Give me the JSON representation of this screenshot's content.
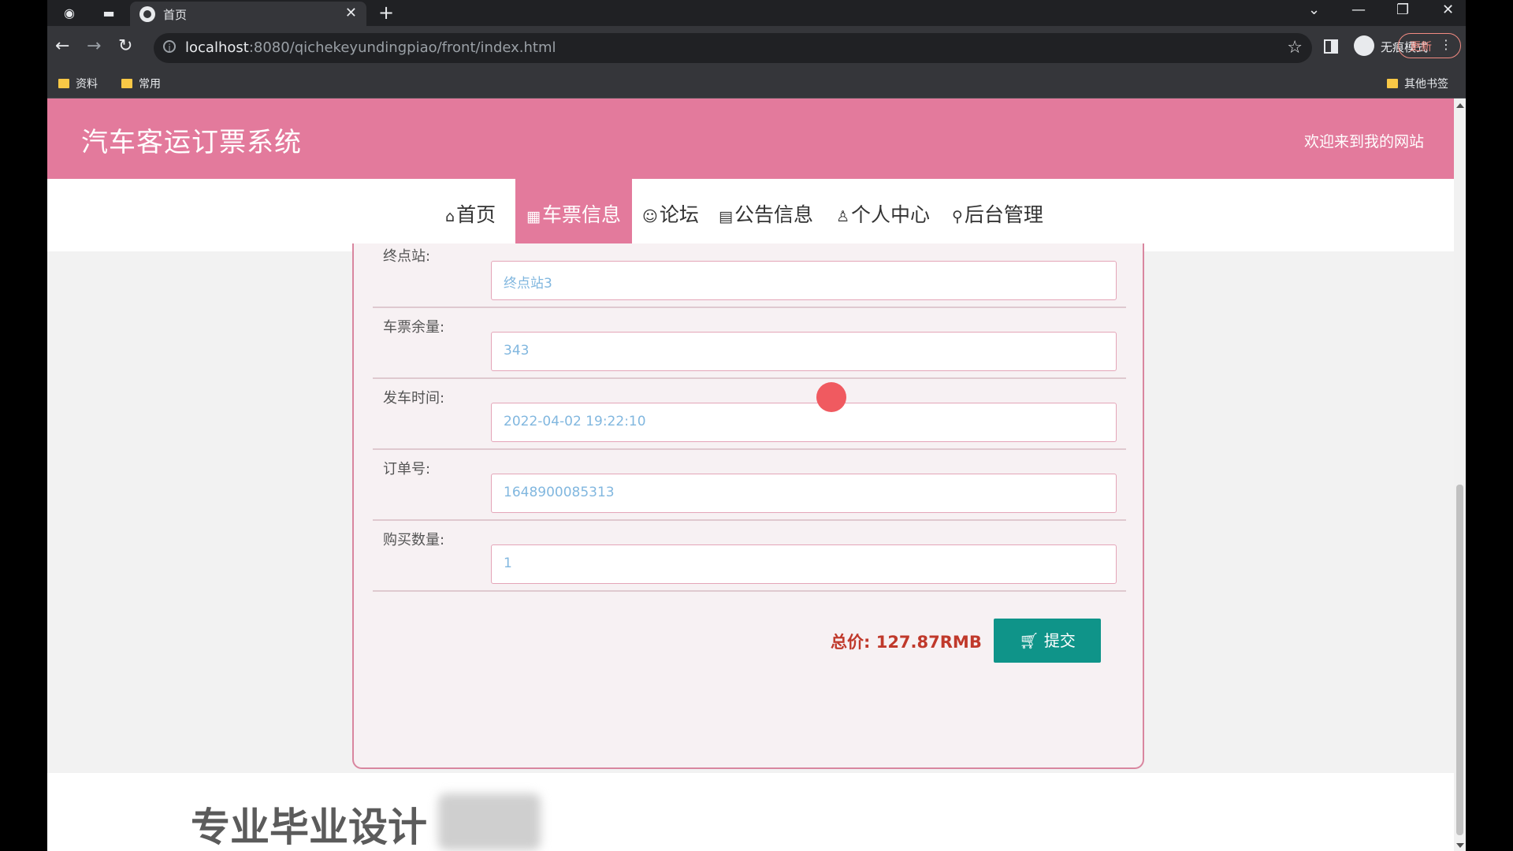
{
  "browser": {
    "tab_title": "首页",
    "url_host": "localhost",
    "url_rest": ":8080/qichekeyundingpiao/front/index.html",
    "incognito_label": "无痕模式",
    "update_label": "更新",
    "bookmarks": [
      "资料",
      "常用"
    ],
    "other_bookmarks": "其他书签"
  },
  "site": {
    "title": "汽车客运订票系统",
    "welcome": "欢迎来到我的网站"
  },
  "nav": [
    {
      "label": "首页",
      "icon": "home-icon"
    },
    {
      "label": "车票信息",
      "icon": "grid-icon",
      "active": true
    },
    {
      "label": "论坛",
      "icon": "chat-icon"
    },
    {
      "label": "公告信息",
      "icon": "clipboard-icon"
    },
    {
      "label": "个人中心",
      "icon": "person-icon"
    },
    {
      "label": "后台管理",
      "icon": "link-icon"
    }
  ],
  "form": {
    "fields": [
      {
        "label": "终点站:",
        "value": "终点站3"
      },
      {
        "label": "车票余量:",
        "value": "343"
      },
      {
        "label": "发车时间:",
        "value": "2022-04-02 19:22:10"
      },
      {
        "label": "订单号:",
        "value": "1648900085313"
      },
      {
        "label": "购买数量:",
        "value": "1"
      }
    ],
    "total": "总价: 127.87RMB",
    "submit_label": "提交"
  },
  "watermark": "专业毕业设计",
  "colors": {
    "header": "#e37a9c",
    "submit": "#0f9489",
    "total": "#c0392b"
  }
}
